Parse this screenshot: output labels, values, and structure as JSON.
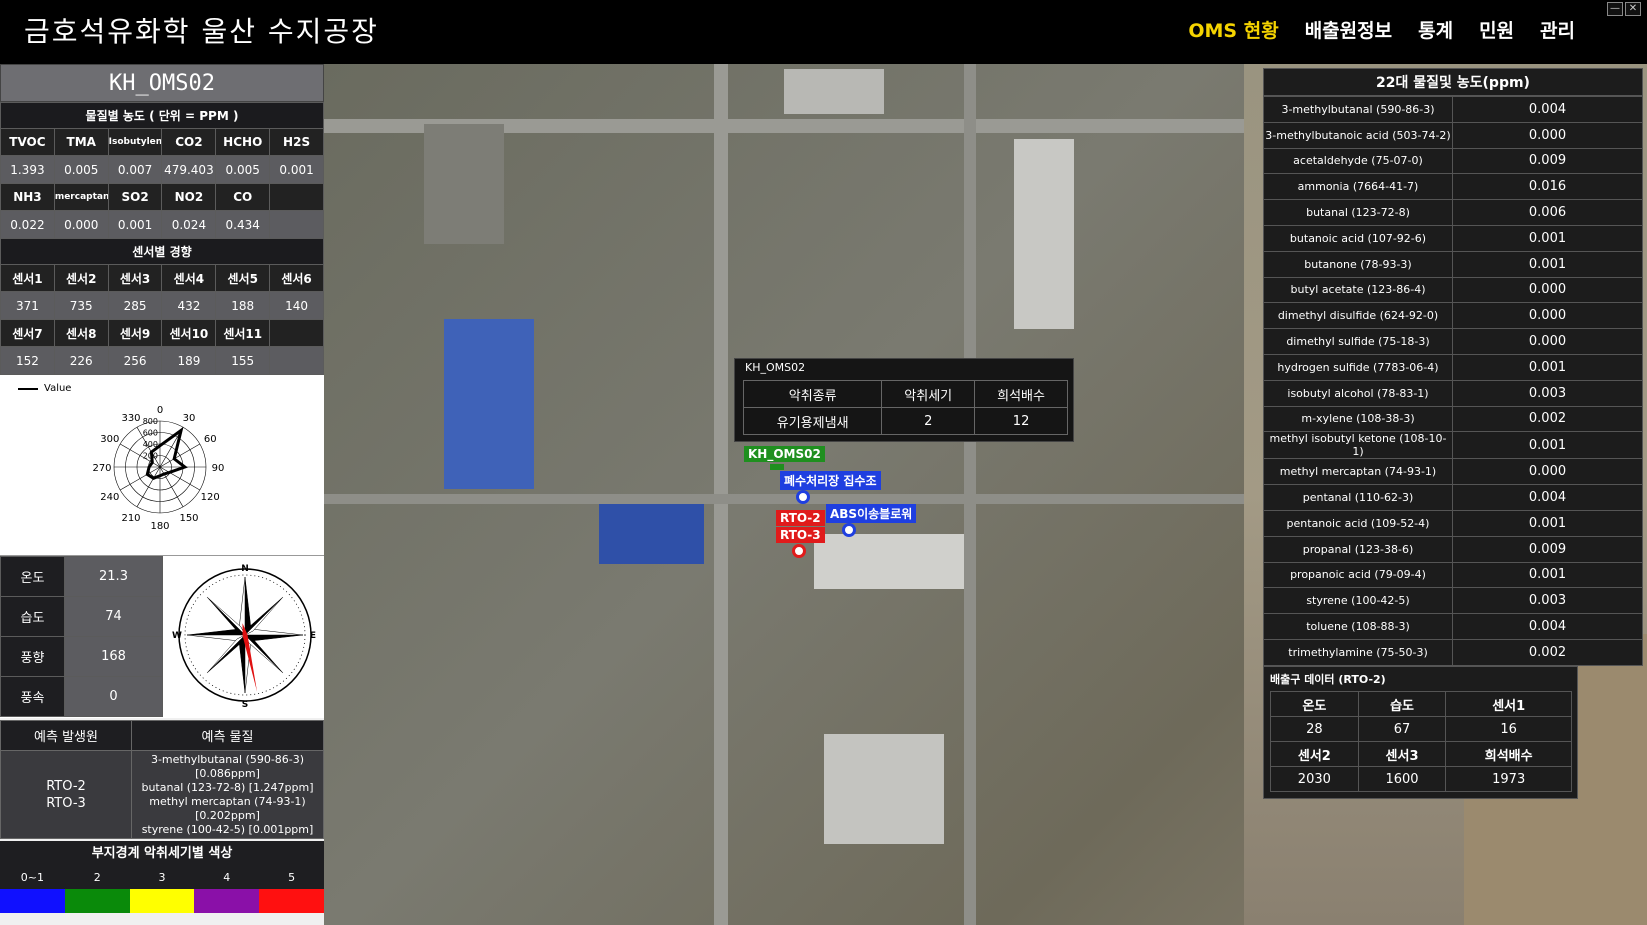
{
  "header": {
    "title": "금호석유화학 울산 수지공장",
    "nav": [
      "OMS 현황",
      "배출원정보",
      "통계",
      "민원",
      "관리"
    ],
    "active_nav": 0
  },
  "left": {
    "station": "KH_OMS02",
    "conc_title": "물질별 농도 ( 단위 = PPM )",
    "row1_headers": [
      "TVOC",
      "TMA",
      "Isobutylene",
      "CO2",
      "HCHO",
      "H2S"
    ],
    "row1_values": [
      "1.393",
      "0.005",
      "0.007",
      "479.403",
      "0.005",
      "0.001"
    ],
    "row2_headers": [
      "NH3",
      "mercaptan",
      "SO2",
      "NO2",
      "CO",
      ""
    ],
    "row2_values": [
      "0.022",
      "0.000",
      "0.001",
      "0.024",
      "0.434",
      ""
    ],
    "sensor_title": "센서별 경향",
    "sensor_row1_headers": [
      "센서1",
      "센서2",
      "센서3",
      "센서4",
      "센서5",
      "센서6"
    ],
    "sensor_row1_values": [
      "371",
      "735",
      "285",
      "432",
      "188",
      "140"
    ],
    "sensor_row2_headers": [
      "센서7",
      "센서8",
      "센서9",
      "센서10",
      "센서11",
      ""
    ],
    "sensor_row2_values": [
      "152",
      "226",
      "256",
      "189",
      "155",
      ""
    ],
    "radar": {
      "legend": "Value",
      "angle_labels": [
        "0",
        "30",
        "60",
        "90",
        "120",
        "150",
        "180",
        "210",
        "240",
        "270",
        "300",
        "330"
      ],
      "ring_labels": [
        "800",
        "600",
        "400",
        "200"
      ],
      "values": [
        371,
        735,
        285,
        432,
        188,
        140,
        152,
        226,
        256,
        189,
        155,
        300
      ]
    },
    "weather": {
      "labels": [
        "온도",
        "습도",
        "풍향",
        "풍속"
      ],
      "values": [
        "21.3",
        "74",
        "168",
        "0"
      ],
      "wind_direction_deg": 168
    },
    "compass_letters": [
      "N",
      "E",
      "S",
      "W"
    ],
    "predict": {
      "col1": "예측 발생원",
      "col2": "예측 물질",
      "sources": [
        "RTO-2",
        "RTO-3"
      ],
      "substances": [
        "3-methylbutanal (590-86-3)",
        "[0.086ppm]",
        "butanal (123-72-8) [1.247ppm]",
        "methyl mercaptan (74-93-1)",
        "[0.202ppm]",
        "styrene (100-42-5) [0.001ppm]"
      ]
    },
    "colorbar": {
      "title": "부지경계 악취세기별 색상",
      "labels": [
        "0~1",
        "2",
        "3",
        "4",
        "5"
      ],
      "colors": [
        "#1010ff",
        "#0a8a0a",
        "#ffff00",
        "#8a10a8",
        "#ff1010"
      ]
    }
  },
  "map": {
    "popup": {
      "title": "KH_OMS02",
      "headers": [
        "악취종류",
        "악취세기",
        "희석배수"
      ],
      "values": [
        "유기용제냄새",
        "2",
        "12"
      ]
    },
    "tags": {
      "station": "KH_OMS02",
      "wastewater": "폐수처리장 집수조",
      "abs": "ABS이송블로워",
      "rto2": "RTO-2",
      "rto3": "RTO-3"
    }
  },
  "right": {
    "title": "22대 물질및 농도(ppm)",
    "rows": [
      [
        "3-methylbutanal (590-86-3)",
        "0.004"
      ],
      [
        "3-methylbutanoic acid (503-74-2)",
        "0.000"
      ],
      [
        "acetaldehyde (75-07-0)",
        "0.009"
      ],
      [
        "ammonia (7664-41-7)",
        "0.016"
      ],
      [
        "butanal (123-72-8)",
        "0.006"
      ],
      [
        "butanoic acid (107-92-6)",
        "0.001"
      ],
      [
        "butanone (78-93-3)",
        "0.001"
      ],
      [
        "butyl acetate (123-86-4)",
        "0.000"
      ],
      [
        "dimethyl disulfide (624-92-0)",
        "0.000"
      ],
      [
        "dimethyl sulfide (75-18-3)",
        "0.000"
      ],
      [
        "hydrogen sulfide (7783-06-4)",
        "0.001"
      ],
      [
        "isobutyl alcohol (78-83-1)",
        "0.003"
      ],
      [
        "m-xylene (108-38-3)",
        "0.002"
      ],
      [
        "methyl isobutyl ketone (108-10-1)",
        "0.001"
      ],
      [
        "methyl mercaptan (74-93-1)",
        "0.000"
      ],
      [
        "pentanal (110-62-3)",
        "0.004"
      ],
      [
        "pentanoic acid (109-52-4)",
        "0.001"
      ],
      [
        "propanal (123-38-6)",
        "0.009"
      ],
      [
        "propanoic acid (79-09-4)",
        "0.001"
      ],
      [
        "styrene (100-42-5)",
        "0.003"
      ],
      [
        "toluene (108-88-3)",
        "0.004"
      ],
      [
        "trimethylamine (75-50-3)",
        "0.002"
      ]
    ],
    "emit": {
      "title": "배출구 데이터 (RTO-2)",
      "headers1": [
        "온도",
        "습도",
        "센서1"
      ],
      "values1": [
        "28",
        "67",
        "16"
      ],
      "headers2": [
        "센서2",
        "센서3",
        "희석배수"
      ],
      "values2": [
        "2030",
        "1600",
        "1973"
      ]
    }
  }
}
